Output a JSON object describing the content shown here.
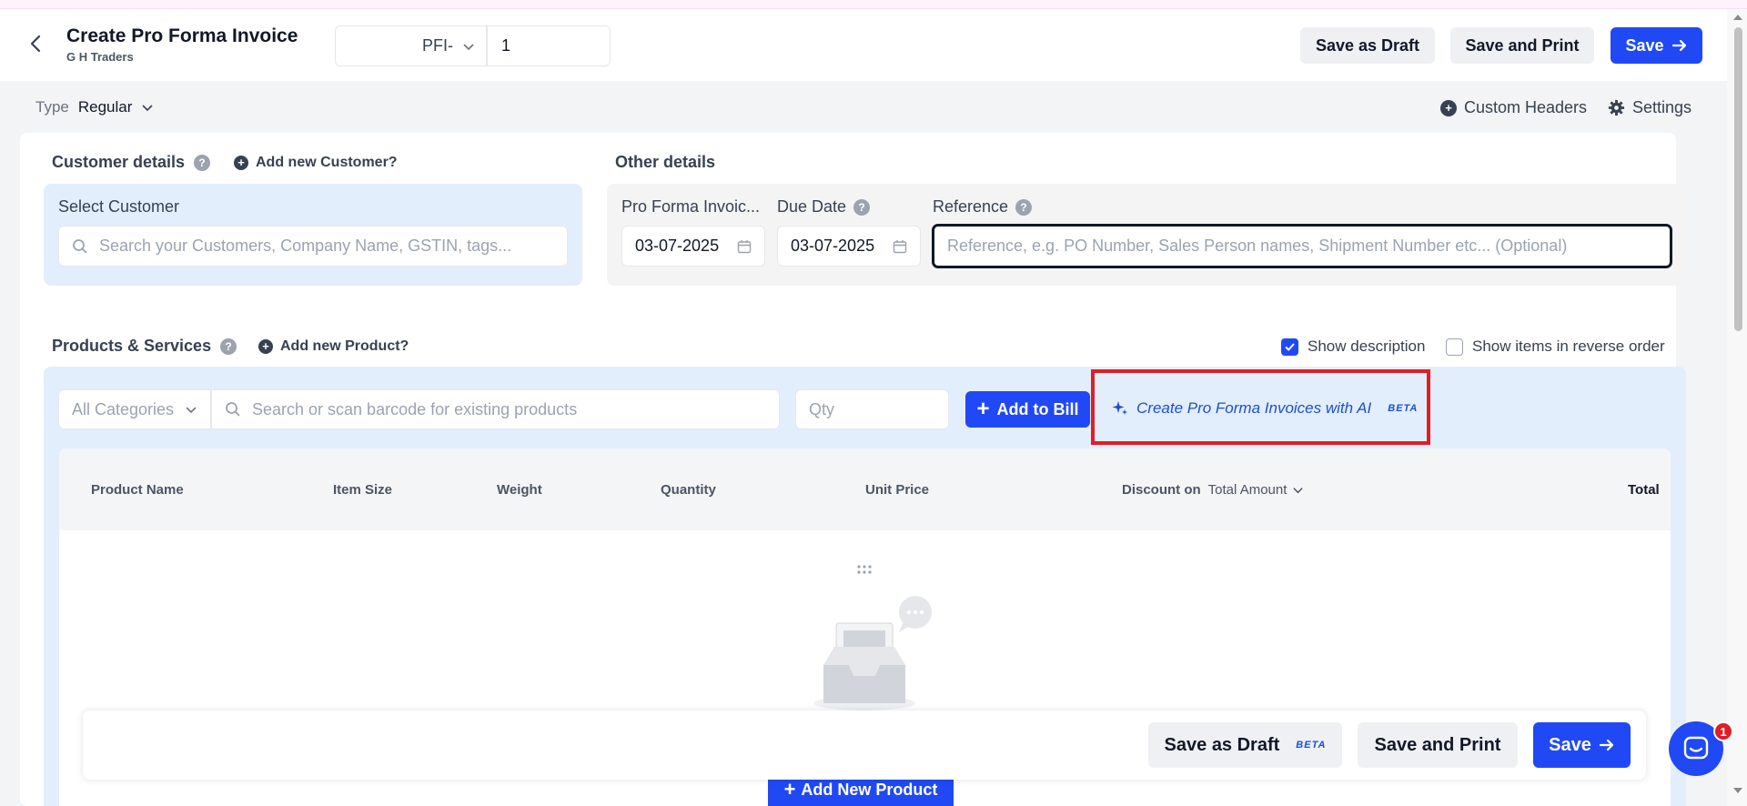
{
  "header": {
    "title": "Create Pro Forma Invoice",
    "company": "G H Traders",
    "prefix": "PFI-",
    "number": "1",
    "save_draft": "Save as Draft",
    "save_print": "Save and Print",
    "save": "Save"
  },
  "typebar": {
    "label": "Type",
    "value": "Regular",
    "custom_headers": "Custom Headers",
    "settings": "Settings"
  },
  "customer": {
    "section": "Customer details",
    "add_new": "Add new Customer?",
    "select_label": "Select Customer",
    "search_placeholder": "Search your Customers, Company Name, GSTIN, tags..."
  },
  "other": {
    "section": "Other details",
    "invoice_date_label": "Pro Forma Invoic...",
    "invoice_date": "03-07-2025",
    "due_date_label": "Due Date",
    "due_date": "03-07-2025",
    "reference_label": "Reference",
    "reference_placeholder": "Reference, e.g. PO Number, Sales Person names, Shipment Number etc... (Optional)"
  },
  "products": {
    "section": "Products & Services",
    "add_new": "Add new Product?",
    "show_description": "Show description",
    "show_description_checked": true,
    "reverse_order": "Show items in reverse order",
    "reverse_order_checked": false,
    "category": "All Categories",
    "search_placeholder": "Search or scan barcode for existing products",
    "qty_placeholder": "Qty",
    "add_to_bill": "Add to Bill",
    "ai_link": "Create Pro Forma Invoices with AI",
    "ai_badge": "BETA",
    "columns": [
      "Product Name",
      "Item Size",
      "Weight",
      "Quantity",
      "Unit Price",
      "Discount on",
      "Total"
    ],
    "discount_mode": "Total Amount",
    "add_new_product": "Add New Product"
  },
  "footer": {
    "save_draft": "Save as Draft",
    "draft_badge": "BETA",
    "save_print": "Save and Print",
    "save": "Save"
  },
  "chat": {
    "badge_count": "1"
  },
  "colors": {
    "accent": "#2049f5",
    "highlight": "#e11d26",
    "panel": "#e3eefc"
  }
}
